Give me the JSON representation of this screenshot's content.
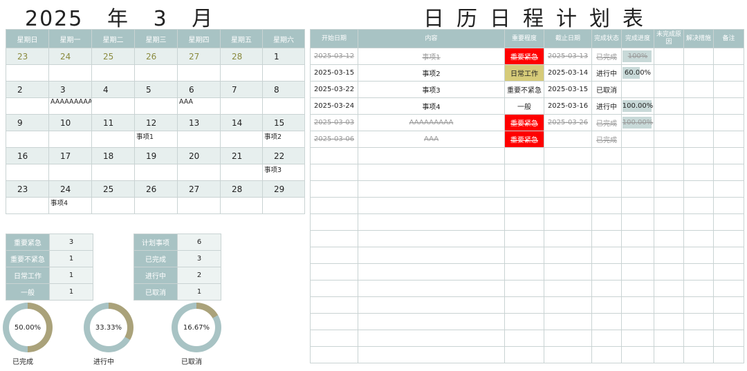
{
  "header": {
    "year": "2025",
    "year_unit": "年",
    "month": "3",
    "month_unit": "月",
    "title": "日历日程计划表"
  },
  "calendar": {
    "weekdays": [
      "星期日",
      "星期一",
      "星期二",
      "星期三",
      "星期四",
      "星期五",
      "星期六"
    ],
    "weeks": [
      {
        "days": [
          "23",
          "24",
          "25",
          "26",
          "27",
          "28",
          "1"
        ],
        "prev": [
          true,
          true,
          true,
          true,
          true,
          true,
          false
        ],
        "events": [
          "",
          "",
          "",
          "",
          "",
          "",
          ""
        ]
      },
      {
        "days": [
          "2",
          "3",
          "4",
          "5",
          "6",
          "7",
          "8"
        ],
        "prev": [
          false,
          false,
          false,
          false,
          false,
          false,
          false
        ],
        "events": [
          "",
          "AAAAAAAAA",
          "",
          "",
          "AAA",
          "",
          ""
        ]
      },
      {
        "days": [
          "9",
          "10",
          "11",
          "12",
          "13",
          "14",
          "15"
        ],
        "prev": [
          false,
          false,
          false,
          false,
          false,
          false,
          false
        ],
        "events": [
          "",
          "",
          "",
          "事项1",
          "",
          "",
          "事项2"
        ]
      },
      {
        "days": [
          "16",
          "17",
          "18",
          "19",
          "20",
          "21",
          "22"
        ],
        "prev": [
          false,
          false,
          false,
          false,
          false,
          false,
          false
        ],
        "events": [
          "",
          "",
          "",
          "",
          "",
          "",
          "事项3"
        ]
      },
      {
        "days": [
          "23",
          "24",
          "25",
          "26",
          "27",
          "28",
          "29"
        ],
        "prev": [
          false,
          false,
          false,
          false,
          false,
          false,
          false
        ],
        "events": [
          "",
          "事项4",
          "",
          "",
          "",
          "",
          ""
        ]
      }
    ]
  },
  "priority_stats": [
    {
      "label": "重要紧急",
      "value": "3"
    },
    {
      "label": "重要不紧急",
      "value": "1"
    },
    {
      "label": "日常工作",
      "value": "1"
    },
    {
      "label": "一般",
      "value": "1"
    }
  ],
  "status_stats": [
    {
      "label": "计划事项",
      "value": "6"
    },
    {
      "label": "已完成",
      "value": "3"
    },
    {
      "label": "进行中",
      "value": "2"
    },
    {
      "label": "已取消",
      "value": "1"
    }
  ],
  "donuts": [
    {
      "percent_text": "50.00%",
      "fraction": 0.5,
      "label": "已完成"
    },
    {
      "percent_text": "33.33%",
      "fraction": 0.3333,
      "label": "进行中"
    },
    {
      "percent_text": "16.67%",
      "fraction": 0.1667,
      "label": "已取消"
    }
  ],
  "colors": {
    "accent": "#a8c3c4",
    "donut_fill": "#aaa27a",
    "donut_track": "#a8c3c4",
    "urgent": "#ff0000",
    "daily": "#d6cb79"
  },
  "schedule": {
    "headers": [
      "开始日期",
      "内容",
      "重要程度",
      "截止日期",
      "完成状态",
      "完成进度",
      "未完成原因",
      "解决措施",
      "备注"
    ],
    "rows": [
      {
        "start": "2025-03-12",
        "content": "事项1",
        "priority": "重要紧急",
        "priority_type": "urgent",
        "end": "2025-03-13",
        "status": "已完成",
        "progress": "100%",
        "progress_frac": 1.0,
        "done": true
      },
      {
        "start": "2025-03-15",
        "content": "事项2",
        "priority": "日常工作",
        "priority_type": "daily",
        "end": "2025-03-14",
        "status": "进行中",
        "progress": "60.00%",
        "progress_frac": 0.6,
        "done": false
      },
      {
        "start": "2025-03-22",
        "content": "事项3",
        "priority": "重要不紧急",
        "priority_type": "",
        "end": "2025-03-15",
        "status": "已取消",
        "progress": "",
        "progress_frac": 0,
        "done": false
      },
      {
        "start": "2025-03-24",
        "content": "事项4",
        "priority": "一般",
        "priority_type": "",
        "end": "2025-03-16",
        "status": "进行中",
        "progress": "100.00%",
        "progress_frac": 1.0,
        "done": false
      },
      {
        "start": "2025-03-03",
        "content": "AAAAAAAAA",
        "priority": "重要紧急",
        "priority_type": "urgent",
        "end": "2025-03-26",
        "status": "已完成",
        "progress": "100.00%",
        "progress_frac": 1.0,
        "done": true
      },
      {
        "start": "2025-03-06",
        "content": "AAA",
        "priority": "重要紧急",
        "priority_type": "urgent",
        "end": "",
        "status": "已完成",
        "progress": "",
        "progress_frac": 0,
        "done": true
      }
    ],
    "empty_rows": 13
  }
}
